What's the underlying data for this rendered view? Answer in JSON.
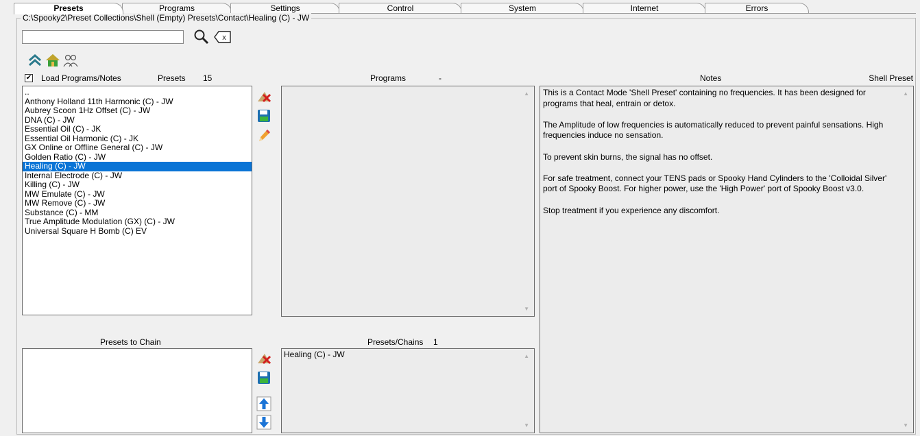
{
  "tabs": [
    "Presets",
    "Programs",
    "Settings",
    "Control",
    "System",
    "Internet",
    "Errors"
  ],
  "active_tab": "Presets",
  "path": "C:\\Spooky2\\Preset Collections\\Shell (Empty) Presets\\Contact\\Healing (C) - JW",
  "search": {
    "value": ""
  },
  "load_checkbox": {
    "checked": "✔",
    "label": "Load Programs/Notes"
  },
  "presets_header": {
    "label": "Presets",
    "count": "15"
  },
  "programs_header": {
    "label": "Programs",
    "count": "-"
  },
  "notes_header": {
    "label": "Notes",
    "type": "Shell Preset"
  },
  "presets_list": [
    "..",
    "Anthony Holland 11th Harmonic (C) - JW",
    "Aubrey Scoon 1Hz Offset (C) - JW",
    "DNA (C) - JW",
    "Essential Oil (C) - JK",
    "Essential Oil Harmonic (C) - JK",
    "GX Online or Offline General (C) - JW",
    "Golden Ratio (C) - JW",
    "Healing (C) - JW",
    "Internal Electrode (C) - JW",
    "Killing (C) - JW",
    "MW Emulate (C) - JW",
    "MW Remove (C) - JW",
    "Substance (C) - MM",
    "True Amplitude Modulation (GX) (C) - JW",
    "Universal Square H Bomb (C) EV"
  ],
  "selected_preset": "Healing (C) - JW",
  "notes_paragraphs": [
    "This is a Contact Mode 'Shell Preset' containing no frequencies. It has been designed for programs that heal, entrain or detox.",
    "The Amplitude of low frequencies is automatically reduced to prevent painful sensations. High frequencies induce no sensation.",
    "To prevent skin burns, the signal has no offset.",
    "For safe treatment, connect your TENS pads or Spooky Hand Cylinders to the 'Colloidal Silver' port of Spooky Boost. For higher power, use the 'High Power' port of Spooky Boost v3.0.",
    "Stop treatment if you experience any discomfort."
  ],
  "chain_header": {
    "label": "Presets to Chain"
  },
  "chains_header": {
    "label": "Presets/Chains",
    "count": "1"
  },
  "chains_list": [
    "Healing (C) - JW"
  ],
  "icons": {
    "search": "magnifier-icon",
    "clear": "clear-search-icon",
    "up": "up-folder-icon",
    "home": "home-icon",
    "users": "users-icon",
    "delete": "delete-icon",
    "save": "save-icon",
    "edit": "edit-icon",
    "move_up": "arrow-up-icon",
    "move_down": "arrow-down-icon"
  },
  "colors": {
    "selection": "#0a74d6",
    "list_bg": "#ffffff",
    "panel_bg": "#ececec"
  }
}
